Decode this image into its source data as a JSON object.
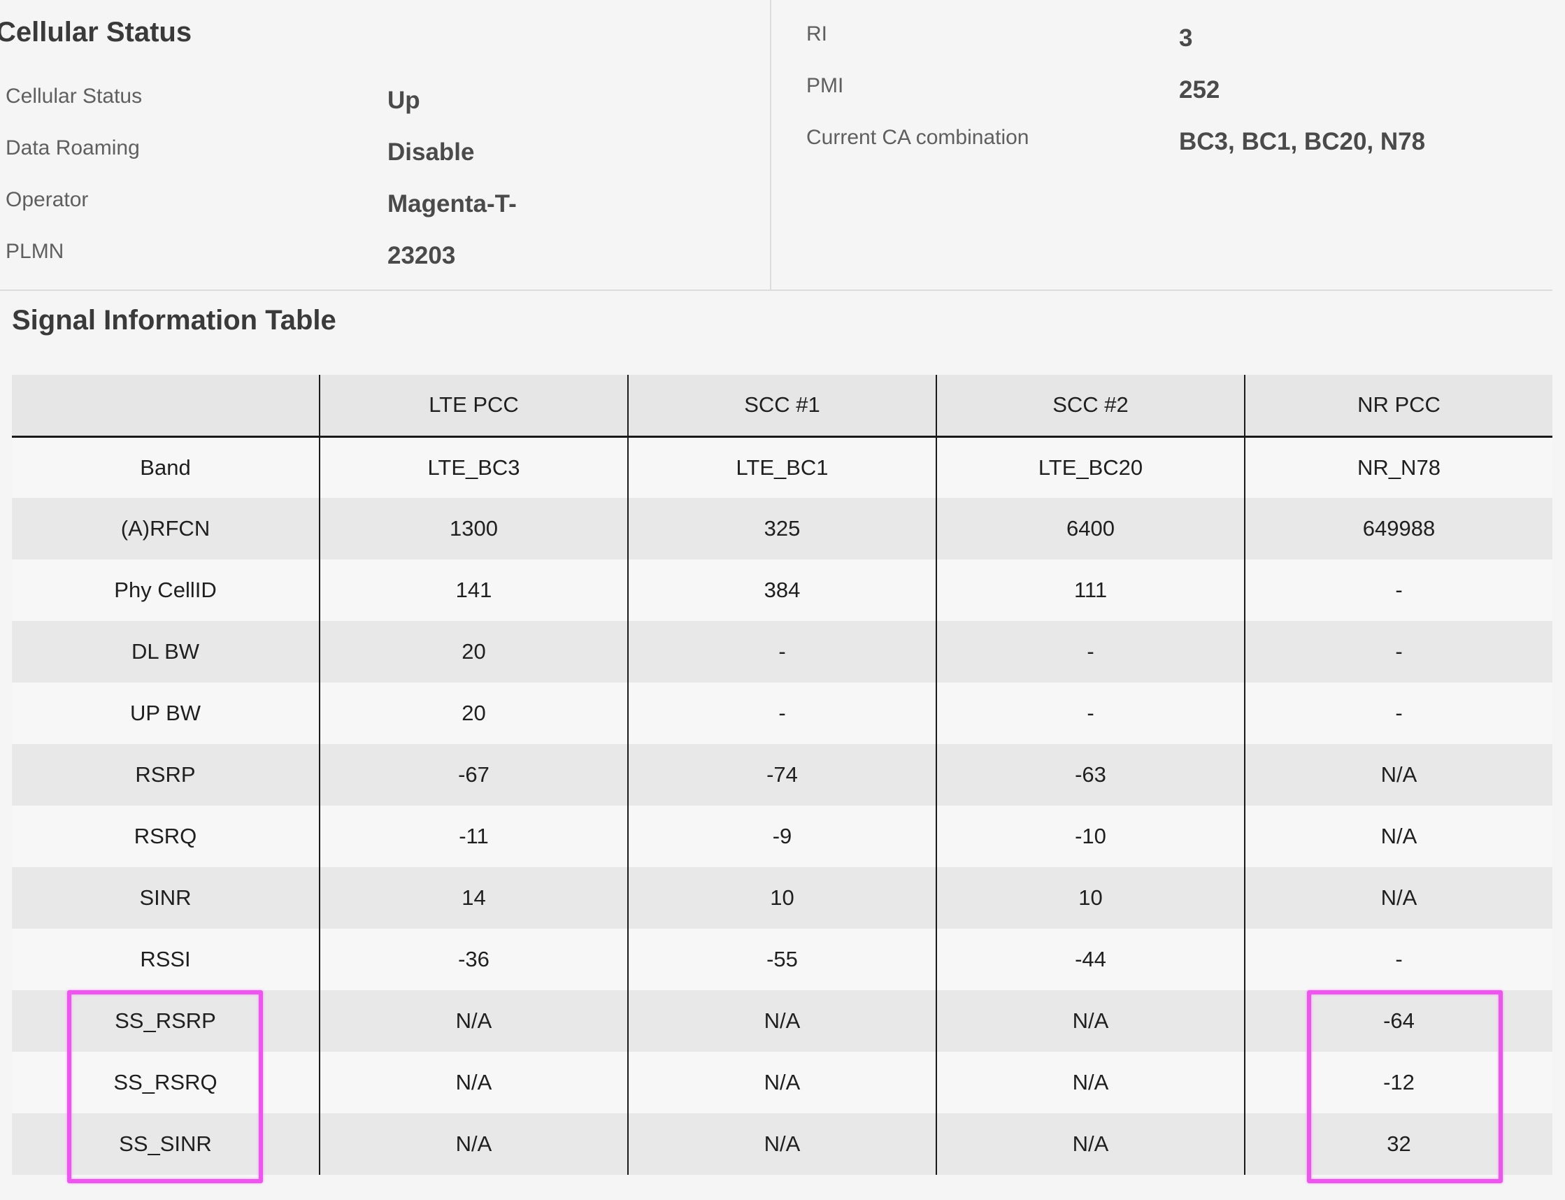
{
  "cellular_status": {
    "title": "Cellular Status",
    "rows": [
      {
        "label": "Cellular Status",
        "value": "Up"
      },
      {
        "label": "Data Roaming",
        "value": "Disable"
      },
      {
        "label": "Operator",
        "value": "Magenta-T-"
      },
      {
        "label": "PLMN",
        "value": "23203"
      }
    ]
  },
  "ca_info": {
    "rows": [
      {
        "label": "RI",
        "value": "3"
      },
      {
        "label": "PMI",
        "value": "252"
      },
      {
        "label": "Current CA combination",
        "value": "BC3, BC1, BC20, N78"
      }
    ]
  },
  "signal_table": {
    "title": "Signal Information Table",
    "headers": [
      "",
      "LTE PCC",
      "SCC #1",
      "SCC #2",
      "NR PCC"
    ],
    "rows": [
      [
        "Band",
        "LTE_BC3",
        "LTE_BC1",
        "LTE_BC20",
        "NR_N78"
      ],
      [
        "(A)RFCN",
        "1300",
        "325",
        "6400",
        "649988"
      ],
      [
        "Phy CellID",
        "141",
        "384",
        "111",
        "-"
      ],
      [
        "DL BW",
        "20",
        "-",
        "-",
        "-"
      ],
      [
        "UP BW",
        "20",
        "-",
        "-",
        "-"
      ],
      [
        "RSRP",
        "-67",
        "-74",
        "-63",
        "N/A"
      ],
      [
        "RSRQ",
        "-11",
        "-9",
        "-10",
        "N/A"
      ],
      [
        "SINR",
        "14",
        "10",
        "10",
        "N/A"
      ],
      [
        "RSSI",
        "-36",
        "-55",
        "-44",
        "-"
      ],
      [
        "SS_RSRP",
        "N/A",
        "N/A",
        "N/A",
        "-64"
      ],
      [
        "SS_RSRQ",
        "N/A",
        "N/A",
        "N/A",
        "-12"
      ],
      [
        "SS_SINR",
        "N/A",
        "N/A",
        "N/A",
        "32"
      ]
    ]
  },
  "annotation": {
    "highlight_color": "#ee55ee"
  }
}
